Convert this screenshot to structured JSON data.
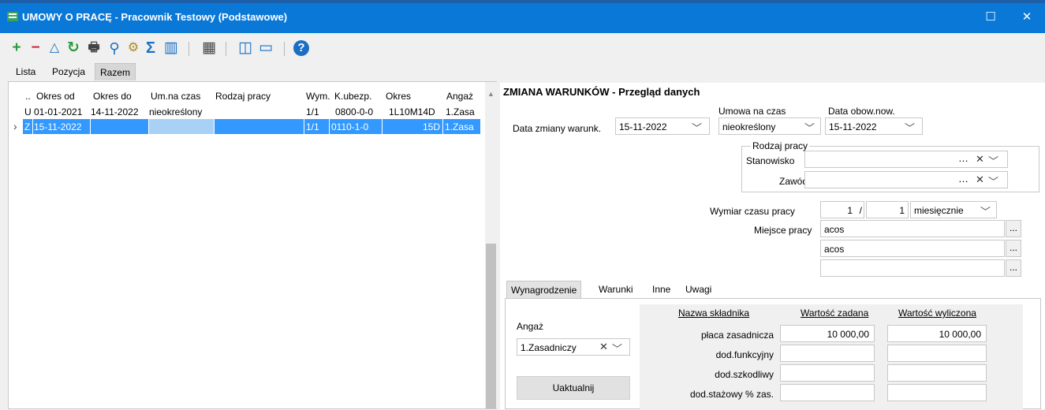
{
  "window": {
    "title": "UMOWY O PRACĘ - Pracownik Testowy (Podstawowe)",
    "maximize_glyph": "☐",
    "close_glyph": "✕"
  },
  "toolbar": [
    {
      "name": "add-icon",
      "glyph": "+",
      "color": "#2a9d3a"
    },
    {
      "name": "remove-icon",
      "glyph": "−",
      "color": "#d0283a"
    },
    {
      "name": "edit-triangle-icon",
      "glyph": "△",
      "color": "#1a6fc4"
    },
    {
      "name": "refresh-icon",
      "glyph": "↻",
      "color": "#2a9d3a"
    },
    {
      "name": "print-icon",
      "glyph": "🖶",
      "color": "#444444"
    },
    {
      "name": "search-icon",
      "glyph": "⚲",
      "color": "#1a6fc4"
    },
    {
      "name": "settings-icon",
      "glyph": "⚙",
      "color": "#b08a20"
    },
    {
      "name": "sum-icon",
      "glyph": "Σ",
      "color": "#1a6fc4"
    },
    {
      "name": "columns-icon",
      "glyph": "▥",
      "color": "#1a6fc4"
    },
    {
      "name": "calculator-icon",
      "glyph": "▦",
      "color": "#444444"
    },
    {
      "name": "split-view-icon",
      "glyph": "◫",
      "color": "#1a6fc4"
    },
    {
      "name": "screen-icon",
      "glyph": "▭",
      "color": "#1a6fc4"
    },
    {
      "name": "help-icon",
      "glyph": "?",
      "color": "#1a6fc4"
    }
  ],
  "top_tabs": [
    "Lista",
    "Pozycja",
    "Razem"
  ],
  "grid": {
    "headers": [
      "..",
      "Okres od",
      "Okres do",
      "Um.na czas",
      "Rodzaj pracy",
      "Wym.",
      "K.ubezp.",
      "Okres",
      "Angaż"
    ],
    "rows": [
      {
        "type": "U",
        "okres_od": "01-01-2021",
        "okres_do": "14-11-2022",
        "um_na_czas": "nieokreślony",
        "rodzaj_pracy": "",
        "wym": "1/1",
        "k_ubezp": "0800-0-0",
        "okres": "1L10M14D",
        "angaz": "1.Zasa"
      },
      {
        "type": "Z",
        "okres_od": "15-11-2022",
        "okres_do": "",
        "um_na_czas": "",
        "rodzaj_pracy": "",
        "wym": "1/1",
        "k_ubezp": "0110-1-0",
        "okres": "15D",
        "angaz": "1.Zasa"
      }
    ]
  },
  "form": {
    "title": "ZMIANA WARUNKÓW - Przegląd danych",
    "data_zmiany_label": "Data zmiany warunk.",
    "data_zmiany_value": "15-11-2022",
    "umowa_na_czas_label": "Umowa na czas",
    "umowa_na_czas_value": "nieokreślony",
    "data_obow_label": "Data obow.now.",
    "data_obow_value": "15-11-2022",
    "rodzaj_pracy_label": "Rodzaj pracy",
    "stanowisko_label": "Stanowisko",
    "zawod_label": "Zawód",
    "wymiar_label": "Wymiar czasu pracy",
    "wymiar_num": "1",
    "wymiar_sep": "/",
    "wymiar_den": "1",
    "wymiar_period": "miesięcznie",
    "miejsce_label": "Miejsce pracy",
    "miejsce_lines": [
      "acos",
      "acos",
      ""
    ]
  },
  "sub_tabs": [
    "Wynagrodzenie",
    "Warunki",
    "Inne",
    "Uwagi"
  ],
  "wynagrodzenie": {
    "angaz_label": "Angaż",
    "angaz_value": "1.Zasadniczy",
    "update_button": "Uaktualnij",
    "col_name": "Nazwa składnika",
    "col_zadana": "Wartość zadana",
    "col_wyliczona": "Wartość wyliczona",
    "components": [
      {
        "name": "płaca zasadnicza",
        "zadana": "10 000,00",
        "wyliczona": "10 000,00"
      },
      {
        "name": "dod.funkcyjny",
        "zadana": "",
        "wyliczona": ""
      },
      {
        "name": "dod.szkodliwy",
        "zadana": "",
        "wyliczona": ""
      },
      {
        "name": "dod.stażowy % zas.",
        "zadana": "",
        "wyliczona": ""
      }
    ]
  }
}
